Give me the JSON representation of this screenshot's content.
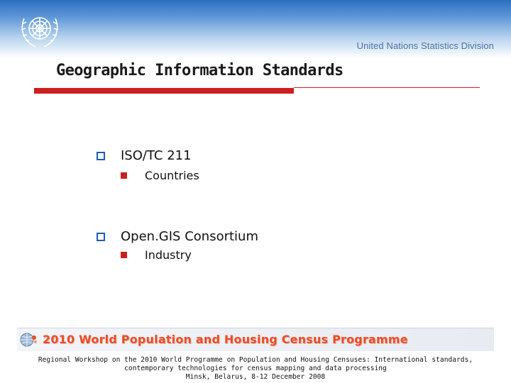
{
  "header": {
    "organization": "United Nations Statistics Division",
    "logo_icon": "un-emblem-icon"
  },
  "slide": {
    "title": "Geographic Information Standards",
    "items": [
      {
        "label": "ISO/TC 211",
        "sub": "Countries"
      },
      {
        "label": "Open.GIS Consortium",
        "sub": "Industry"
      }
    ]
  },
  "banner": {
    "text": "2010 World Population and Housing Census Programme",
    "icon": "globe-icon"
  },
  "footer": {
    "line1": "Regional Workshop on the 2010 World Programme on Population and Housing Censuses: International standards,",
    "line2": "contemporary technologies for census mapping and data processing",
    "line3": "Minsk, Belarus, 8-12 December 2008"
  },
  "colors": {
    "header_blue": "#2e6fc0",
    "accent_red": "#cc1f1f",
    "bullet_blue": "#1a5fb4",
    "banner_orange": "#e84e2a"
  }
}
